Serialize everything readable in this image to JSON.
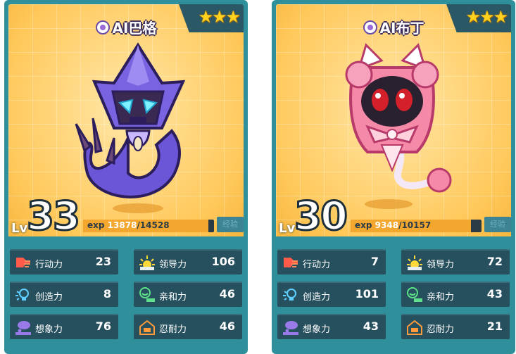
{
  "cards": [
    {
      "name": "AI巴格",
      "stars": "★★★",
      "level": "33",
      "lv_label": "Lv",
      "exp_label": "exp",
      "exp_current": "13878",
      "exp_total": "/14528",
      "exp_fraction": 0.955,
      "exp_button": "经验",
      "stats": [
        {
          "label": "行动力",
          "value": "23",
          "icon": "action-icon"
        },
        {
          "label": "领导力",
          "value": "106",
          "icon": "leadership-icon"
        },
        {
          "label": "创造力",
          "value": "8",
          "icon": "creativity-icon"
        },
        {
          "label": "亲和力",
          "value": "46",
          "icon": "affinity-icon"
        },
        {
          "label": "想象力",
          "value": "76",
          "icon": "imagination-icon"
        },
        {
          "label": "忍耐力",
          "value": "46",
          "icon": "endurance-icon"
        }
      ]
    },
    {
      "name": "AI布丁",
      "stars": "★★★",
      "level": "30",
      "lv_label": "Lv",
      "exp_label": "exp",
      "exp_current": "9348",
      "exp_total": "/10157",
      "exp_fraction": 0.92,
      "exp_button": "经验",
      "stats": [
        {
          "label": "行动力",
          "value": "7",
          "icon": "action-icon"
        },
        {
          "label": "领导力",
          "value": "72",
          "icon": "leadership-icon"
        },
        {
          "label": "创造力",
          "value": "101",
          "icon": "creativity-icon"
        },
        {
          "label": "亲和力",
          "value": "43",
          "icon": "affinity-icon"
        },
        {
          "label": "想象力",
          "value": "43",
          "icon": "imagination-icon"
        },
        {
          "label": "忍耐力",
          "value": "21",
          "icon": "endurance-icon"
        }
      ]
    }
  ],
  "colors": {
    "card_bg": "#2f8f9a",
    "stat_bg": "#27505f",
    "exp_fill": "#f3a72f",
    "star": "#ffd21f"
  }
}
